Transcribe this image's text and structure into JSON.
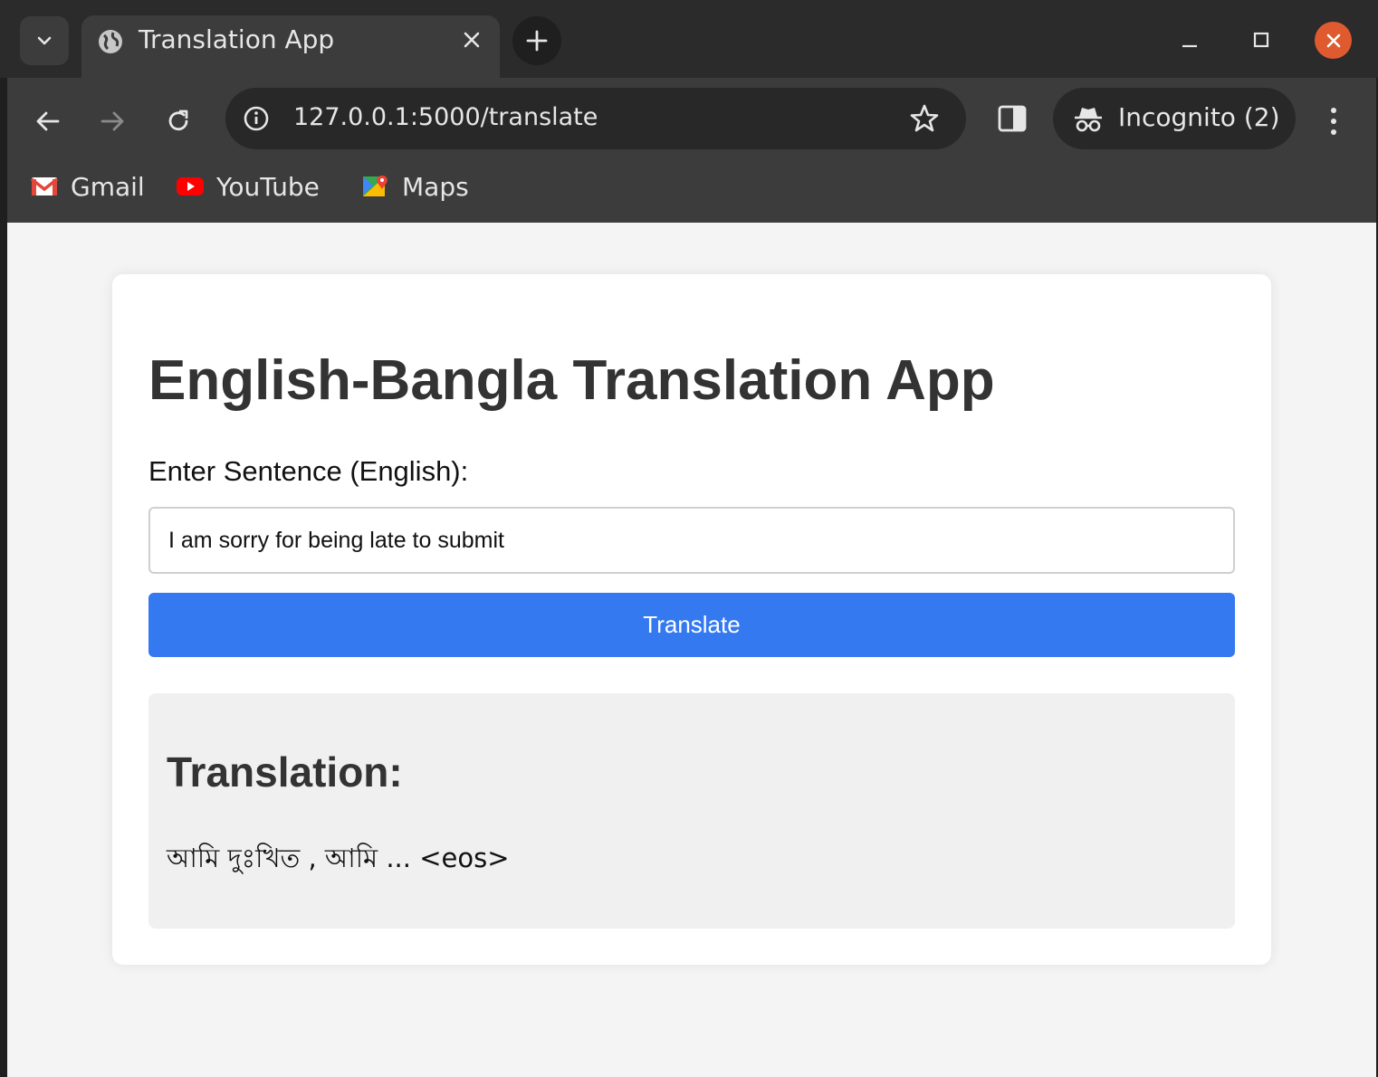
{
  "browser": {
    "tab": {
      "title": "Translation App"
    },
    "address": {
      "url": "127.0.0.1:5000/translate"
    },
    "profile": {
      "label": "Incognito (2)"
    },
    "bookmarks": [
      {
        "label": "Gmail",
        "icon": "gmail-icon"
      },
      {
        "label": "YouTube",
        "icon": "youtube-icon"
      },
      {
        "label": "Maps",
        "icon": "maps-icon"
      }
    ]
  },
  "app": {
    "heading": "English-Bangla Translation App",
    "input_label": "Enter Sentence (English):",
    "input_value": "I am sorry for being late to submit",
    "button_label": "Translate",
    "result_heading": "Translation:",
    "result_text": "আমি দুঃখিত , আমি ... <eos>"
  },
  "colors": {
    "accent": "#3479f0",
    "close": "#e05a30",
    "page_bg": "#f4f4f4"
  }
}
